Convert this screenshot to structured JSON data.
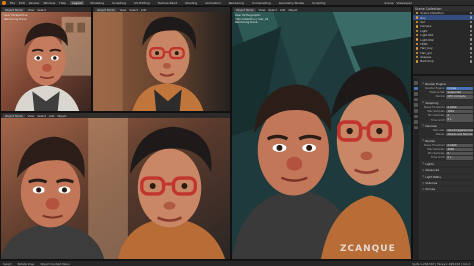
{
  "topbar": {
    "menus": [
      "File",
      "Edit",
      "Render",
      "Window",
      "Help"
    ],
    "workspaces": [
      "Layout",
      "Modeling",
      "Sculpting",
      "UV Editing",
      "Texture Paint",
      "Shading",
      "Animation",
      "Rendering",
      "Compositing",
      "Geometry Nodes",
      "Scripting"
    ],
    "active_workspace": "Layout",
    "scene_label": "Scene",
    "view_layer_label": "ViewLayer"
  },
  "viewports": {
    "top_left": {
      "shading": "Object Mode",
      "menu": [
        "View",
        "Select",
        "Add",
        "Object"
      ],
      "info": [
        "User Perspective",
        "Rendering Done"
      ]
    },
    "top_middle": {
      "shading": "Object Mode",
      "menu": [
        "View",
        "Select",
        "Add",
        "Object"
      ]
    },
    "bottom_left": {
      "shading": "Object Mode",
      "menu": [
        "View",
        "Select",
        "Add",
        "Object"
      ]
    },
    "right": {
      "shading": "Object Mode",
      "menu": [
        "View",
        "Select",
        "Add",
        "Object"
      ],
      "info": [
        "User Orthographic",
        "(49) Collection | hair_01",
        "Rendering Done"
      ]
    }
  },
  "outliner": {
    "title": "Scene Collection",
    "rows": [
      "Scene Collection",
      "Boy",
      "Girl",
      "Camera",
      "Light",
      "Light.001",
      "Light.002",
      "HDRI",
      "Hair_boy",
      "Hair_girl",
      "Glasses",
      "Backdrop"
    ],
    "selected_index": 1
  },
  "properties": {
    "sections": [
      {
        "title": "Render Engine",
        "rows": [
          [
            "Render Engine",
            "Cycles"
          ],
          [
            "Feature Set",
            "Supported"
          ],
          [
            "Device",
            "GPU Compute"
          ]
        ]
      },
      {
        "title": "Sampling",
        "rows": [
          [
            "Noise Threshold",
            "0.0100"
          ],
          [
            "Max Samples",
            "1024"
          ],
          [
            "Min Samples",
            "0"
          ],
          [
            "Time Limit",
            "0 s"
          ]
        ]
      },
      {
        "title": "Denoise",
        "rows": [
          [
            "Denoiser",
            "OpenImageDenoise"
          ],
          [
            "Passes",
            "Albedo and Normal"
          ]
        ]
      },
      {
        "title": "Render",
        "rows": [
          [
            "Noise Threshold",
            "0.0100"
          ],
          [
            "Max Samples",
            "4096"
          ],
          [
            "Min Samples",
            "0"
          ],
          [
            "Time Limit",
            "0 s"
          ]
        ]
      },
      {
        "title": "Lights",
        "rows": []
      },
      {
        "title": "Advanced",
        "rows": []
      },
      {
        "title": "Light Paths",
        "rows": []
      },
      {
        "title": "Volumes",
        "rows": []
      },
      {
        "title": "Curves",
        "rows": []
      }
    ]
  },
  "statusbar": {
    "items": [
      "Select",
      "Rotate View",
      "Object Context Menu"
    ],
    "version": "Verts 1,234,567 | Faces 1,198,432 | 4.0.2"
  },
  "watermark": "ZCANQUE",
  "colors": {
    "accent": "#4772b3",
    "selection": "#334d80",
    "blender_orange": "#e87d0d"
  }
}
